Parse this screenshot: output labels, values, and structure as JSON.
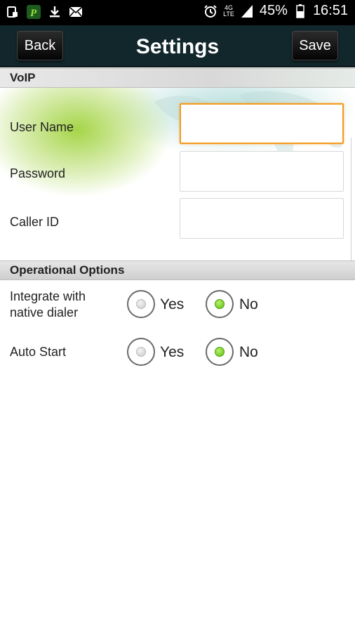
{
  "status_bar": {
    "icons_left": [
      "screenshot-icon",
      "p-app-icon",
      "download-icon",
      "mail-icon"
    ],
    "alarm_icon": "alarm-icon",
    "network_label_top": "4G",
    "network_label_bottom": "LTE",
    "signal_icon": "signal-icon",
    "battery_percent": "45%",
    "battery_icon": "battery-icon",
    "time": "16:51"
  },
  "title_bar": {
    "back_label": "Back",
    "title": "Settings",
    "save_label": "Save"
  },
  "voip": {
    "section_title": "VoIP",
    "fields": [
      {
        "label": "User Name",
        "value": "",
        "focused": true
      },
      {
        "label": "Password",
        "value": ""
      },
      {
        "label": "Caller ID",
        "value": ""
      }
    ]
  },
  "operational": {
    "section_title": "Operational Options",
    "options": [
      {
        "label_line1": "Integrate with",
        "label_line2": "native dialer",
        "yes_label": "Yes",
        "no_label": "No",
        "selected": "No"
      },
      {
        "label_line1": "Auto Start",
        "label_line2": "",
        "yes_label": "Yes",
        "no_label": "No",
        "selected": "No"
      }
    ]
  },
  "colors": {
    "title_bar_bg": "#12272c",
    "focus_border": "#f39a1e",
    "radio_selected": "#5cbf10"
  }
}
